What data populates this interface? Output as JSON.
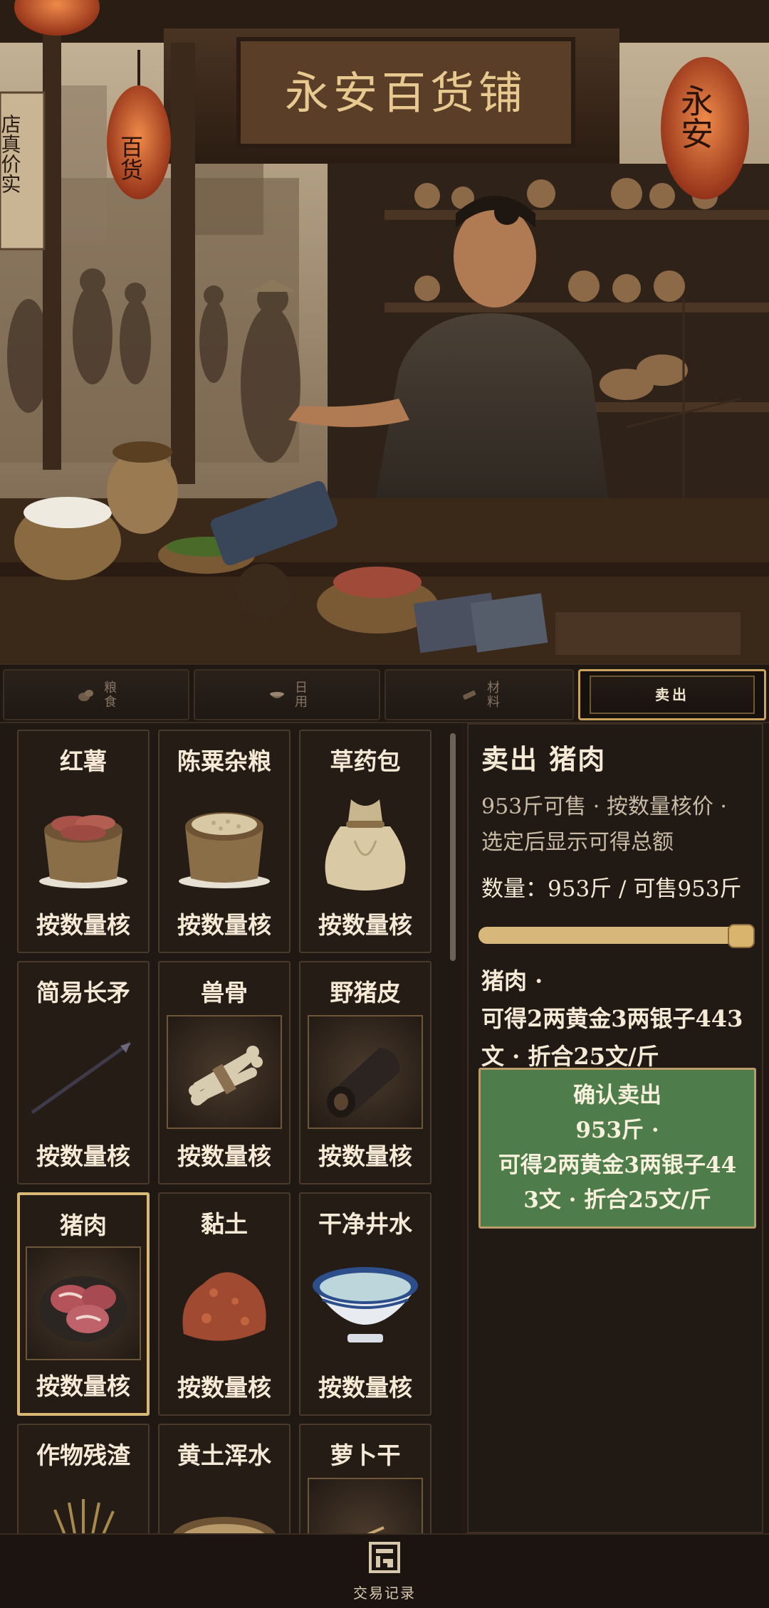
{
  "scene": {
    "shop_sign": "永安百货铺",
    "lantern_left": "百货",
    "lantern_right": "永安",
    "banner_left": "店真价实"
  },
  "tabs": [
    {
      "label": "粮食",
      "icon": "grain-icon",
      "active": false
    },
    {
      "label": "日用",
      "icon": "bowl-icon",
      "active": false
    },
    {
      "label": "材料",
      "icon": "material-icon",
      "active": false
    },
    {
      "label": "卖出",
      "icon": "",
      "active": true
    }
  ],
  "items": [
    {
      "name": "红薯",
      "price": "按数量核",
      "icon": "sweet-potato-icon"
    },
    {
      "name": "陈粟杂粮",
      "price": "按数量核",
      "icon": "grain-sack-icon"
    },
    {
      "name": "草药包",
      "price": "按数量核",
      "icon": "herb-bag-icon"
    },
    {
      "name": "简易长矛",
      "price": "按数量核",
      "icon": "spear-icon"
    },
    {
      "name": "兽骨",
      "price": "按数量核",
      "icon": "bone-icon"
    },
    {
      "name": "野猪皮",
      "price": "按数量核",
      "icon": "boar-hide-icon"
    },
    {
      "name": "猪肉",
      "price": "按数量核",
      "icon": "pork-icon"
    },
    {
      "name": "黏土",
      "price": "按数量核",
      "icon": "clay-icon"
    },
    {
      "name": "干净井水",
      "price": "按数量核",
      "icon": "water-bowl-icon"
    },
    {
      "name": "作物残渣",
      "price": "",
      "icon": "straw-icon"
    },
    {
      "name": "黄土浑水",
      "price": "",
      "icon": "muddy-water-icon"
    },
    {
      "name": "萝卜干",
      "price": "",
      "icon": "dried-radish-icon"
    }
  ],
  "selected_item": "猪肉",
  "sell": {
    "title": "卖出 猪肉",
    "desc_line1": "953斤可售 · 按数量核价 ·",
    "desc_line2": "选定后显示可得总额",
    "qty_line": "数量：953斤 / 可售953斤",
    "quantity": 953,
    "max_quantity": 953,
    "result_line1": "猪肉 ·",
    "result_line2": "可得2两黄金3两银子443",
    "result_line3": "文 · 折合25文/斤",
    "confirm_line1": "确认卖出",
    "confirm_line2": "953斤 ·",
    "confirm_line3": "可得2两黄金3两银子44",
    "confirm_line4": "3文 · 折合25文/斤"
  },
  "bottom": {
    "log_label": "交易记录",
    "log_icon": "ledger-icon"
  },
  "colors": {
    "accent_gold": "#d9b774",
    "confirm_green": "#4e7c4a",
    "panel_bg": "#211914"
  }
}
